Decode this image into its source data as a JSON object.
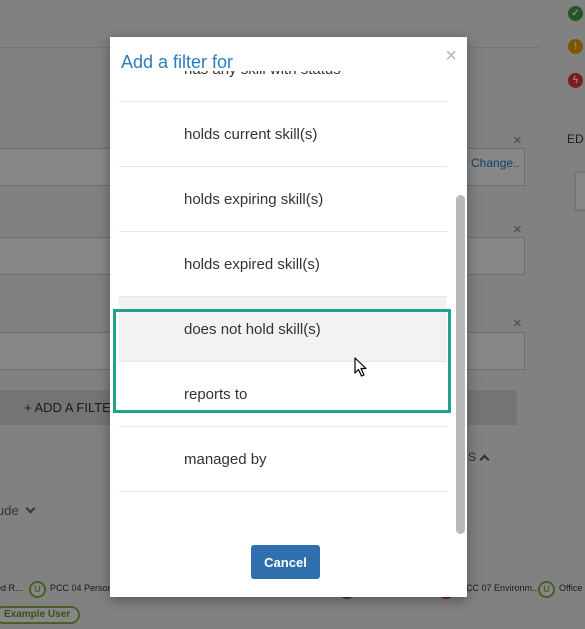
{
  "modal": {
    "title": "Add a filter for",
    "close_glyph": "×",
    "options": [
      {
        "label": "has any skill with status"
      },
      {
        "label": "holds current skill(s)"
      },
      {
        "label": "holds expiring skill(s)"
      },
      {
        "label": "holds expired skill(s)"
      },
      {
        "label": "does not hold skill(s)",
        "hovered": true
      },
      {
        "label": "reports to"
      },
      {
        "label": "managed by"
      }
    ],
    "cancel_label": "Cancel"
  },
  "background": {
    "change_link": "Change..",
    "add_filter_label": "+ ADD A FILTE",
    "show_hide_fragment": "S",
    "exclude_fragment": "ude",
    "edge_label": "ED",
    "status_icons": [
      {
        "name": "check-circle-icon",
        "color": "#43a047",
        "glyph": "✓"
      },
      {
        "name": "warning-circle-icon",
        "color": "#f0a000",
        "glyph": "!"
      },
      {
        "name": "bolt-circle-icon",
        "color": "#e53935",
        "glyph": "ϟ"
      }
    ],
    "tags": [
      "ed R...",
      "PCC 04 Person",
      "CC 07 Environm...",
      "Office"
    ],
    "user_pill": "Example User"
  },
  "colors": {
    "accent": "#2b7dbf",
    "button": "#2f6fae",
    "highlight": "#1fa38c",
    "shield": "#8ab34a"
  }
}
